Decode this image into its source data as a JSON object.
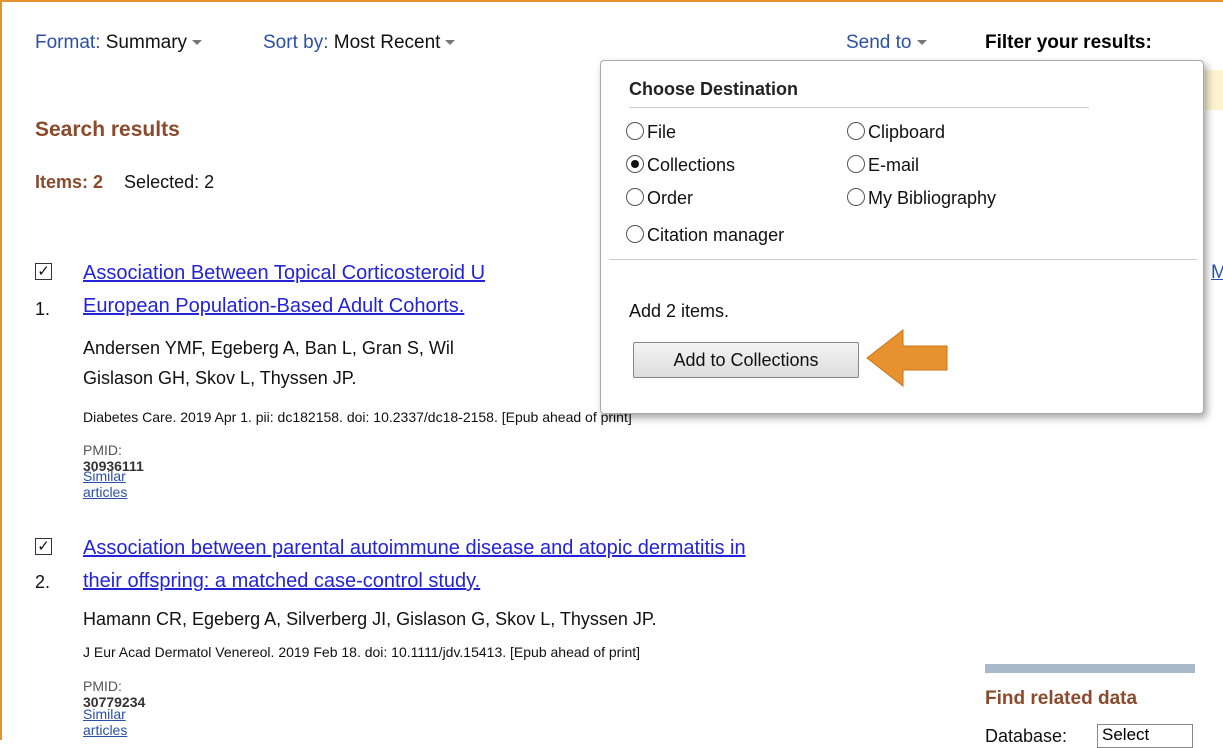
{
  "toolbar": {
    "format_label": "Format",
    "format_value": "Summary",
    "sortby_label": "Sort by",
    "sortby_value": "Most Recent",
    "sendto_label": "Send to",
    "filter_heading": "Filter your results:"
  },
  "results": {
    "heading": "Search results",
    "items_label": "Items: 2",
    "selected_label": "Selected: 2",
    "list": [
      {
        "number": "1.",
        "checked": true,
        "title_line1": "Association Between Topical Corticosteroid U",
        "title_line2": "European Population-Based Adult Cohorts.",
        "authors_line1": "Andersen YMF, Egeberg A, Ban L, Gran S, Wil",
        "authors_line2": "Gislason GH, Skov L, Thyssen JP.",
        "journal": "Diabetes Care. 2019 Apr 1. pii: dc182158. doi: 10.2337/dc18-2158. [Epub ahead of print]",
        "pmid_label": "PMID:",
        "pmid": "30936111",
        "similar": "Similar articles"
      },
      {
        "number": "2.",
        "checked": true,
        "title_line1": "Association between parental autoimmune disease and atopic dermatitis in",
        "title_line2": "their offspring: a matched case-control study.",
        "authors_line1": "Hamann CR, Egeberg A, Silverberg JI, Gislason G, Skov L, Thyssen JP.",
        "authors_line2": "",
        "journal": "J Eur Acad Dermatol Venereol. 2019 Feb 18. doi: 10.1111/jdv.15413. [Epub ahead of print]",
        "pmid_label": "PMID:",
        "pmid": "30779234",
        "similar": "Similar articles"
      }
    ]
  },
  "dropdown": {
    "title": "Choose Destination",
    "options": {
      "file": "File",
      "clipboard": "Clipboard",
      "collections": "Collections",
      "email": "E-mail",
      "order": "Order",
      "bibliography": "My Bibliography",
      "citation": "Citation manager"
    },
    "selected_option": "Collections",
    "count_text": "Add 2 items.",
    "button_label": "Add to Collections"
  },
  "right_rail": {
    "edge_link": "M",
    "find_related": "Find related data",
    "database_label": "Database:",
    "database_value": "Select"
  },
  "colors": {
    "accent_orange": "#e8912f",
    "link_blue": "#2324d8",
    "heading_brown": "#8b4a2b"
  }
}
